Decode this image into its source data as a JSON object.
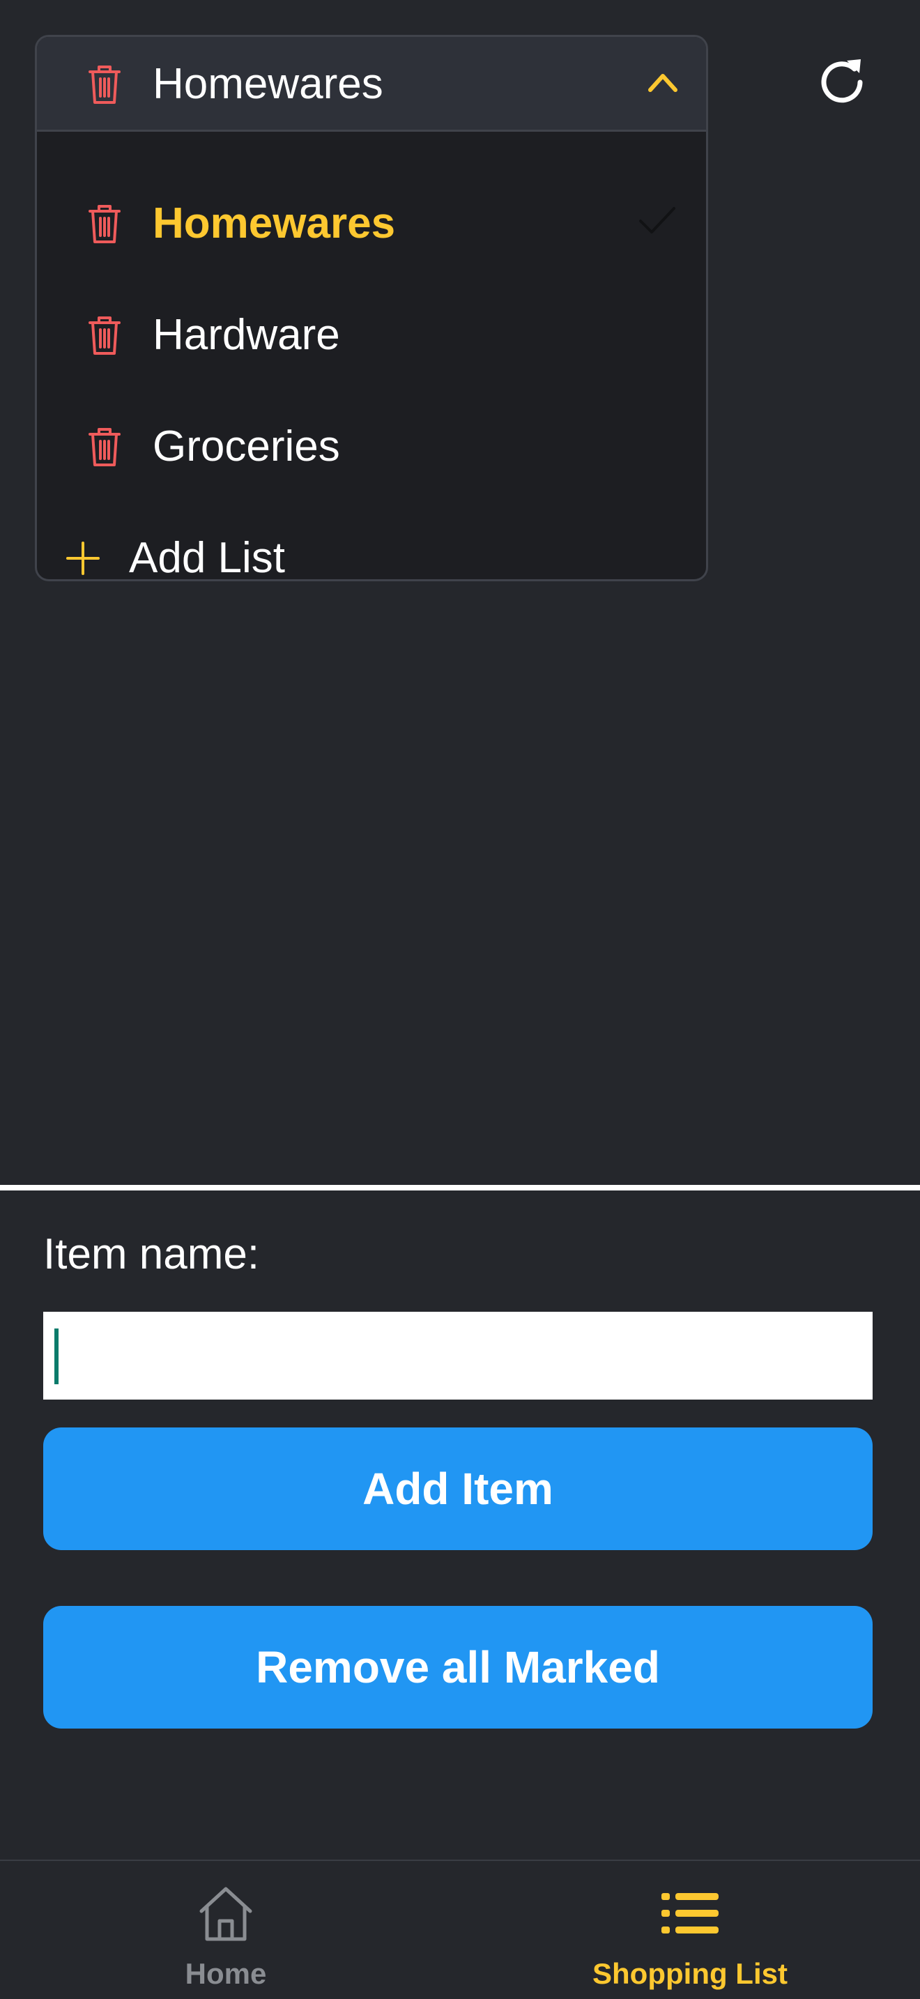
{
  "colors": {
    "background": "#25272c",
    "accent": "#fdc830",
    "trash": "#ef5b5b",
    "button": "#2196f3"
  },
  "dropdown": {
    "selected_label": "Homewares",
    "options": [
      {
        "label": "Homewares",
        "selected": true
      },
      {
        "label": "Hardware",
        "selected": false
      },
      {
        "label": "Groceries",
        "selected": false
      }
    ],
    "add_label": "Add List",
    "icons": {
      "delete": "trash-icon",
      "expand": "chevron-up-icon",
      "selected": "check-icon",
      "add": "plus-icon"
    }
  },
  "toolbar": {
    "refresh_icon": "refresh-icon"
  },
  "form": {
    "item_label": "Item name:",
    "item_value": "",
    "add_button": "Add Item",
    "remove_button": "Remove all Marked"
  },
  "nav": {
    "items": [
      {
        "label": "Home",
        "icon": "home-icon",
        "active": false
      },
      {
        "label": "Shopping List",
        "icon": "list-icon",
        "active": true
      }
    ]
  }
}
